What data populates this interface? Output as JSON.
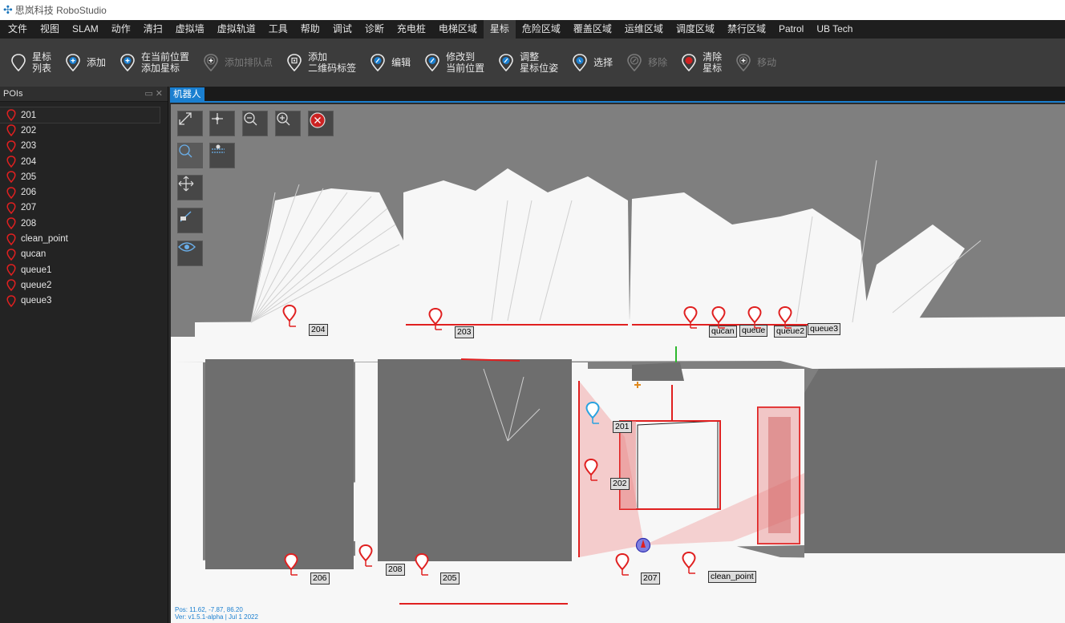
{
  "app": {
    "title": "思岚科技 RoboStudio"
  },
  "menu": [
    "文件",
    "视图",
    "SLAM",
    "动作",
    "清扫",
    "虚拟墙",
    "虚拟轨道",
    "工具",
    "帮助",
    "调试",
    "诊断",
    "充电桩",
    "电梯区域",
    "星标",
    "危险区域",
    "覆盖区域",
    "运维区域",
    "调度区域",
    "禁行区域",
    "Patrol",
    "UB Tech"
  ],
  "menu_active": "星标",
  "toolbar": [
    {
      "label": "星标\n列表",
      "icon": "pin-outline-icon",
      "enabled": true
    },
    {
      "label": "添加",
      "icon": "add-circle-icon",
      "enabled": true
    },
    {
      "label": "在当前位置\n添加星标",
      "icon": "add-at-position-icon",
      "enabled": true
    },
    {
      "label": "添加排队点",
      "icon": "add-queue-icon",
      "enabled": false
    },
    {
      "label": "添加\n二维码标签",
      "icon": "qrcode-pin-icon",
      "enabled": true
    },
    {
      "label": "编辑",
      "icon": "edit-pin-icon",
      "enabled": true
    },
    {
      "label": "修改到\n当前位置",
      "icon": "move-to-current-icon",
      "enabled": true
    },
    {
      "label": "调整\n星标位姿",
      "icon": "adjust-pose-icon",
      "enabled": true
    },
    {
      "label": "选择",
      "icon": "select-pin-icon",
      "enabled": true
    },
    {
      "label": "移除",
      "icon": "remove-pin-icon",
      "enabled": false
    },
    {
      "label": "清除\n星标",
      "icon": "clear-pins-icon",
      "enabled": true
    },
    {
      "label": "移动",
      "icon": "move-pin-icon",
      "enabled": false
    }
  ],
  "panel": {
    "title": "POIs",
    "buttons": "▭ ✕"
  },
  "pois": [
    "201",
    "202",
    "203",
    "204",
    "205",
    "206",
    "207",
    "208",
    "clean_point",
    "qucan",
    "queue1",
    "queue2",
    "queue3"
  ],
  "selected_poi": "201",
  "tab": {
    "label": "机器人"
  },
  "map_labels": {
    "p204": "204",
    "p203": "203",
    "qucan": "qucan",
    "queue1": "queue",
    "queue2": "queue2",
    "queue3": "queue3",
    "p201": "201",
    "p202": "202",
    "p206": "206",
    "p208": "208",
    "p205": "205",
    "p207": "207",
    "clean_point": "clean_point"
  },
  "status": {
    "line1": "Pos: 11.62, -7.87, 86.20",
    "line2": "Ver: v1.5.1-alpha | Jul 1 2022"
  },
  "colors": {
    "accent": "#1a7fd0",
    "poi_red": "#e02020",
    "robot_blue": "#29a3e0",
    "map_free": "#f7f7f7",
    "map_unknown": "#7f7f7f"
  }
}
